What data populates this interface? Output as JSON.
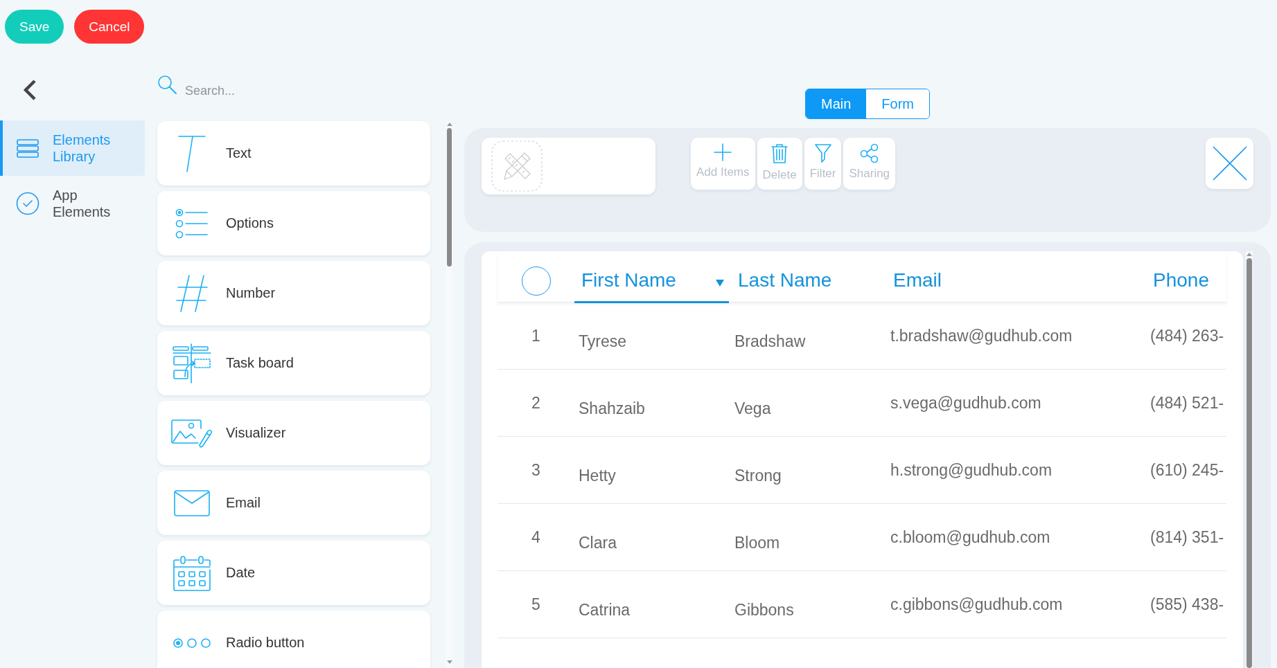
{
  "actions": [
    {
      "label": "Save",
      "kind": "save"
    },
    {
      "label": "Cancel",
      "kind": "cancel"
    }
  ],
  "sidebar": {
    "items": [
      {
        "label": "Elements Library",
        "kind": "library",
        "selected": true
      },
      {
        "label": "App Elements",
        "kind": "app",
        "selected": false
      }
    ]
  },
  "search": {
    "placeholder": "Search..."
  },
  "elements": [
    {
      "label": "Text",
      "kind": "text"
    },
    {
      "label": "Options",
      "kind": "options"
    },
    {
      "label": "Number",
      "kind": "number"
    },
    {
      "label": "Task board",
      "kind": "task_board"
    },
    {
      "label": "Visualizer",
      "kind": "visualizer"
    },
    {
      "label": "Email",
      "kind": "email"
    },
    {
      "label": "Date",
      "kind": "date"
    },
    {
      "label": "Radio button",
      "kind": "radio"
    }
  ],
  "view_tabs": [
    {
      "label": "Main",
      "selected": true
    },
    {
      "label": "Form",
      "selected": false
    }
  ],
  "toolbar": {
    "buttons": [
      {
        "label": "Add Items",
        "kind": "add"
      },
      {
        "label": "Delete",
        "kind": "delete"
      },
      {
        "label": "Filter",
        "kind": "filter"
      },
      {
        "label": "Sharing",
        "kind": "sharing"
      }
    ]
  },
  "table": {
    "select_all": {
      "checked": false
    },
    "columns": [
      {
        "label": "First Name",
        "sorted": true
      },
      {
        "label": "Last Name",
        "sorted": false
      },
      {
        "label": "Email",
        "sorted": false
      },
      {
        "label": "Phone",
        "sorted": false
      }
    ],
    "rows": [
      {
        "number": "1",
        "first_name": "Tyrese",
        "last_name": "Bradshaw",
        "email": "t.bradshaw@gudhub.com",
        "phone": "(484) 263-"
      },
      {
        "number": "2",
        "first_name": "Shahzaib",
        "last_name": "Vega",
        "email": "s.vega@gudhub.com",
        "phone": "(484) 521-"
      },
      {
        "number": "3",
        "first_name": "Hetty",
        "last_name": "Strong",
        "email": "h.strong@gudhub.com",
        "phone": "(610) 245-"
      },
      {
        "number": "4",
        "first_name": "Clara",
        "last_name": "Bloom",
        "email": "c.bloom@gudhub.com",
        "phone": "(814) 351-"
      },
      {
        "number": "5",
        "first_name": "Catrina",
        "last_name": "Gibbons",
        "email": "c.gibbons@gudhub.com",
        "phone": "(585) 438-"
      }
    ]
  }
}
